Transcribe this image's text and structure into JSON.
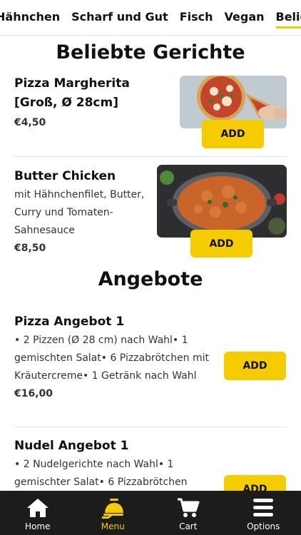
{
  "colors": {
    "accent": "#f5cc00",
    "nav_bg": "#1c1c1c",
    "text": "#111111"
  },
  "category_tabs": [
    {
      "label": "Hähnchen"
    },
    {
      "label": "Scharf und Gut"
    },
    {
      "label": "Fisch"
    },
    {
      "label": "Vegan"
    },
    {
      "label": "Beliebt",
      "active": true
    }
  ],
  "popular": {
    "title": "Beliebte Gerichte",
    "items": [
      {
        "name": "Pizza Margherita [Groß, Ø 28cm]",
        "price": "€4,50",
        "add_label": "ADD",
        "image": "pizza-image"
      },
      {
        "name": "Butter Chicken",
        "description": "mit Hähnchenfilet, Butter, Curry und Tomaten-Sahnesauce",
        "price": "€8,50",
        "add_label": "ADD",
        "image": "butter-chicken-image"
      }
    ]
  },
  "offers": {
    "title": "Angebote",
    "items": [
      {
        "name": "Pizza Angebot 1",
        "description": "• 2 Pizzen (Ø 28 cm) nach Wahl• 1 gemischten Salat• 6 Pizzabrötchen mit Kräutercreme• 1 Getränk nach Wahl",
        "price": "€16,00",
        "add_label": "ADD"
      },
      {
        "name": "Nudel Angebot 1",
        "description": "• 2 Nudelgerichte nach Wahl• 1 gemischter Salat• 6 Pizzabrötchen",
        "add_label": "ADD"
      }
    ]
  },
  "bottom_nav": [
    {
      "label": "Home",
      "icon": "home-icon"
    },
    {
      "label": "Menu",
      "icon": "menu-icon",
      "active": true
    },
    {
      "label": "Cart",
      "icon": "cart-icon"
    },
    {
      "label": "Options",
      "icon": "options-icon"
    }
  ]
}
